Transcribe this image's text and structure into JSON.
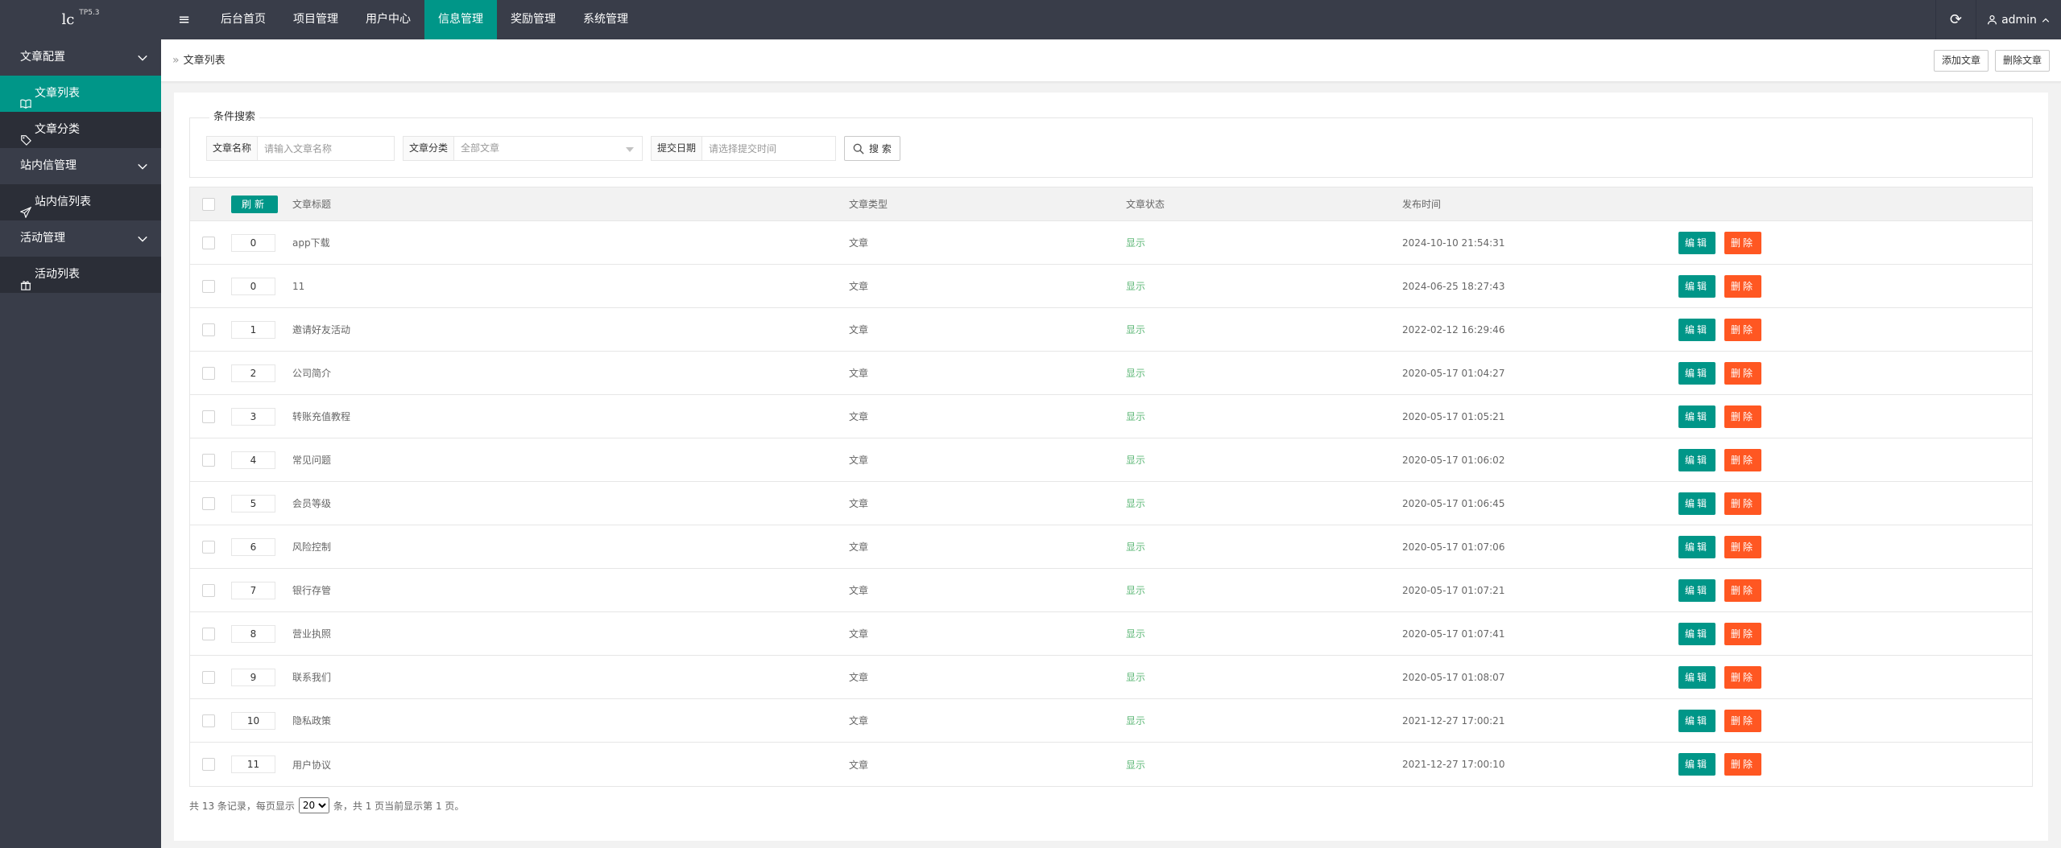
{
  "app": {
    "logo": "lc",
    "version": "TP5.3"
  },
  "topnav": [
    {
      "label": "后台首页",
      "active": false
    },
    {
      "label": "项目管理",
      "active": false
    },
    {
      "label": "用户中心",
      "active": false
    },
    {
      "label": "信息管理",
      "active": true
    },
    {
      "label": "奖励管理",
      "active": false
    },
    {
      "label": "系统管理",
      "active": false
    }
  ],
  "user": {
    "name": "admin"
  },
  "sidebar": [
    {
      "type": "group",
      "label": "文章配置"
    },
    {
      "type": "item",
      "label": "文章列表",
      "icon": "book-icon",
      "active": true
    },
    {
      "type": "item",
      "label": "文章分类",
      "icon": "tag-icon",
      "active": false
    },
    {
      "type": "group",
      "label": "站内信管理"
    },
    {
      "type": "item",
      "label": "站内信列表",
      "icon": "send-icon",
      "active": false
    },
    {
      "type": "group",
      "label": "活动管理"
    },
    {
      "type": "item",
      "label": "活动列表",
      "icon": "gift-icon",
      "active": false
    }
  ],
  "breadcrumb": {
    "separator": "»",
    "current": "文章列表"
  },
  "actions": {
    "add": "添加文章",
    "delete": "删除文章"
  },
  "search": {
    "legend": "条件搜索",
    "name_label": "文章名称",
    "name_placeholder": "请输入文章名称",
    "category_label": "文章分类",
    "category_value": "全部文章",
    "date_label": "提交日期",
    "date_placeholder": "请选择提交时间",
    "button": "搜 索"
  },
  "table": {
    "refresh_label": "刷新",
    "headers": {
      "title": "文章标题",
      "type": "文章类型",
      "status": "文章状态",
      "time": "发布时间"
    },
    "edit_label": "编辑",
    "delete_label": "删除",
    "rows": [
      {
        "sort": "0",
        "title": "app下载",
        "type": "文章",
        "status": "显示",
        "time": "2024-10-10 21:54:31"
      },
      {
        "sort": "0",
        "title": "11",
        "type": "文章",
        "status": "显示",
        "time": "2024-06-25 18:27:43"
      },
      {
        "sort": "1",
        "title": "邀请好友活动",
        "type": "文章",
        "status": "显示",
        "time": "2022-02-12 16:29:46"
      },
      {
        "sort": "2",
        "title": "公司简介",
        "type": "文章",
        "status": "显示",
        "time": "2020-05-17 01:04:27"
      },
      {
        "sort": "3",
        "title": "转账充值教程",
        "type": "文章",
        "status": "显示",
        "time": "2020-05-17 01:05:21"
      },
      {
        "sort": "4",
        "title": "常见问题",
        "type": "文章",
        "status": "显示",
        "time": "2020-05-17 01:06:02"
      },
      {
        "sort": "5",
        "title": "会员等级",
        "type": "文章",
        "status": "显示",
        "time": "2020-05-17 01:06:45"
      },
      {
        "sort": "6",
        "title": "风险控制",
        "type": "文章",
        "status": "显示",
        "time": "2020-05-17 01:07:06"
      },
      {
        "sort": "7",
        "title": "银行存管",
        "type": "文章",
        "status": "显示",
        "time": "2020-05-17 01:07:21"
      },
      {
        "sort": "8",
        "title": "营业执照",
        "type": "文章",
        "status": "显示",
        "time": "2020-05-17 01:07:41"
      },
      {
        "sort": "9",
        "title": "联系我们",
        "type": "文章",
        "status": "显示",
        "time": "2020-05-17 01:08:07"
      },
      {
        "sort": "10",
        "title": "隐私政策",
        "type": "文章",
        "status": "显示",
        "time": "2021-12-27 17:00:21"
      },
      {
        "sort": "11",
        "title": "用户协议",
        "type": "文章",
        "status": "显示",
        "time": "2021-12-27 17:00:10"
      }
    ]
  },
  "pager": {
    "prefix": "共 13 条记录，每页显示",
    "per_page": "20",
    "suffix": "条，共 1 页当前显示第 1 页。"
  },
  "colors": {
    "accent": "#009688",
    "danger": "#ff5722",
    "header_bg": "#393d49",
    "status_green": "#5fb878"
  }
}
